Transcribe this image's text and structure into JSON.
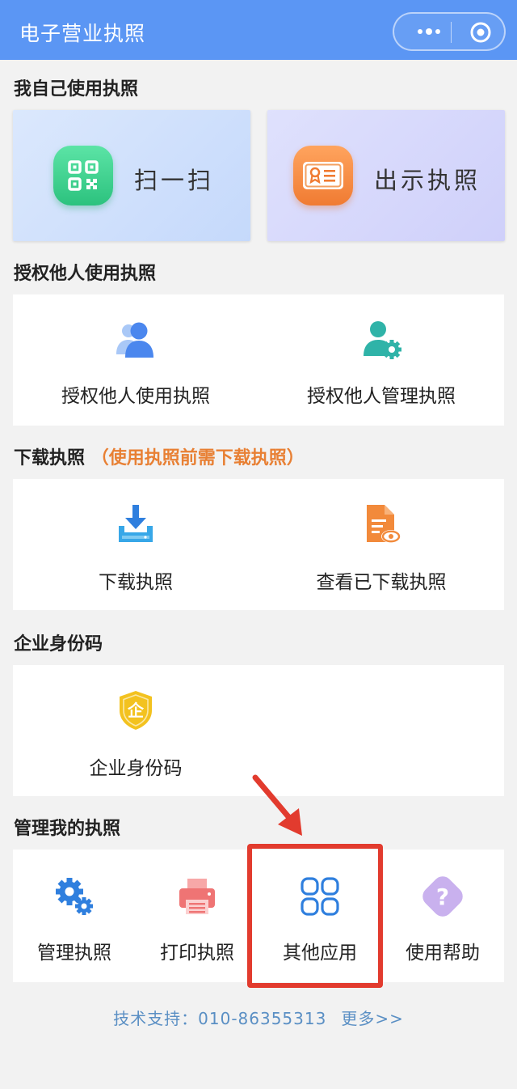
{
  "header": {
    "title": "电子营业执照",
    "more_icon": "more-dots-icon",
    "close_icon": "target-close-icon"
  },
  "sections": {
    "self_use": {
      "title": "我自己使用执照",
      "scan_label": "扫一扫",
      "show_label": "出示执照"
    },
    "authorize": {
      "title": "授权他人使用执照",
      "items": [
        {
          "label": "授权他人使用执照",
          "icon": "users-icon"
        },
        {
          "label": "授权他人管理执照",
          "icon": "user-gear-icon"
        }
      ]
    },
    "download": {
      "title": "下载执照",
      "hint": "（使用执照前需下载执照）",
      "items": [
        {
          "label": "下载执照",
          "icon": "download-icon"
        },
        {
          "label": "查看已下载执照",
          "icon": "document-view-icon"
        }
      ]
    },
    "enterprise_id": {
      "title": "企业身份码",
      "items": [
        {
          "label": "企业身份码",
          "icon": "enterprise-shield-icon",
          "badge": "企"
        }
      ]
    },
    "manage": {
      "title": "管理我的执照",
      "items": [
        {
          "label": "管理执照",
          "icon": "gears-icon"
        },
        {
          "label": "打印执照",
          "icon": "printer-icon"
        },
        {
          "label": "其他应用",
          "icon": "apps-grid-icon"
        },
        {
          "label": "使用帮助",
          "icon": "help-icon",
          "glyph": "?"
        }
      ]
    }
  },
  "footer": {
    "support_label": "技术支持：010-86355313",
    "more_link": "更多>>"
  },
  "colors": {
    "header_bg": "#5b96f4",
    "hint": "#e88034",
    "highlight": "#e23b2e",
    "footer_text": "#5a8fc4"
  }
}
